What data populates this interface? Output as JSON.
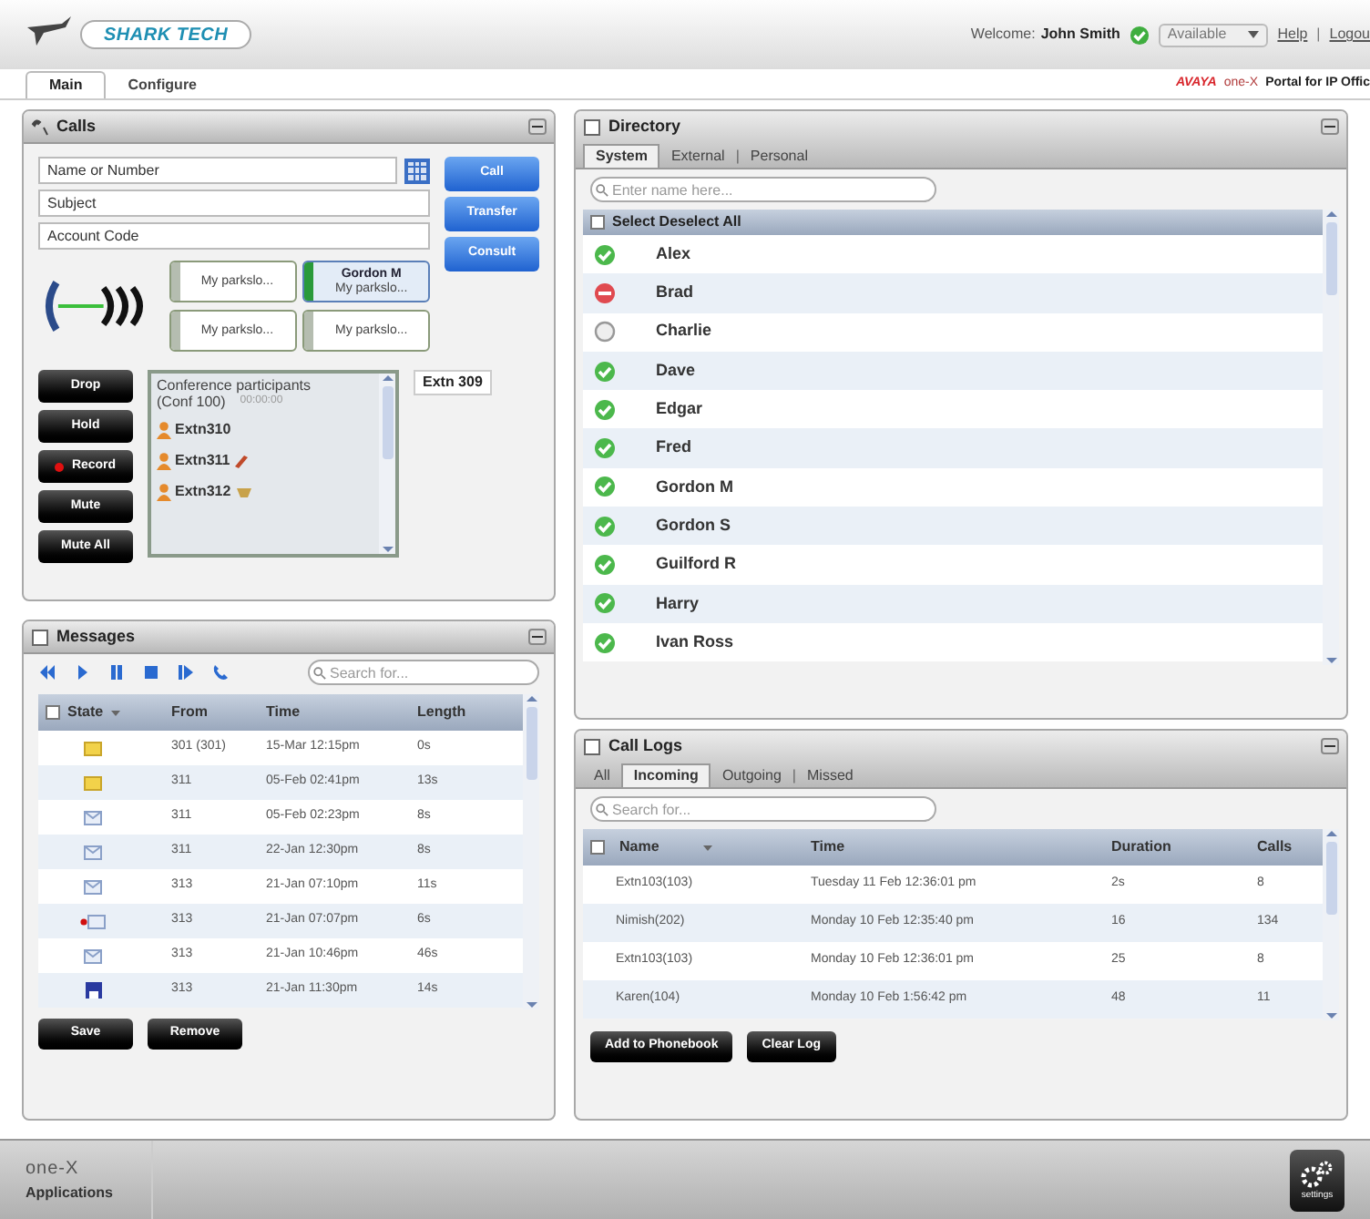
{
  "header": {
    "logo": "SHARK TECH",
    "welcome_label": "Welcome:",
    "user_name": "John Smith",
    "status": "Available",
    "links": [
      {
        "label": "Help",
        "separator_after": "|"
      },
      {
        "label": "Logou"
      }
    ]
  },
  "tabs": [
    {
      "label": "Main",
      "selected": true
    },
    {
      "label": "Configure",
      "selected": false
    }
  ],
  "branding": {
    "vendor": "AVAYA",
    "product": "one-X",
    "portal": "Portal for IP Offic"
  },
  "calls": {
    "title": "Calls",
    "fields": [
      {
        "placeholder": "Name or Number"
      },
      {
        "placeholder": "Subject"
      },
      {
        "placeholder": "Account Code"
      }
    ],
    "action_buttons": [
      "Call",
      "Transfer",
      "Consult"
    ],
    "park_slots": [
      {
        "label": "My parkslo...",
        "active": false
      },
      {
        "name": "Gordon M",
        "label": "My parkslo...",
        "active": true
      },
      {
        "label": "My parkslo...",
        "active": false
      },
      {
        "label": "My parkslo...",
        "active": false
      }
    ],
    "call_controls": [
      {
        "label": "Drop",
        "kind": "plain"
      },
      {
        "label": "Hold",
        "kind": "plain"
      },
      {
        "label": "Record",
        "kind": "record"
      },
      {
        "label": "Mute",
        "kind": "plain"
      },
      {
        "label": "Mute All",
        "kind": "plain"
      }
    ],
    "conference": {
      "title": "Conference participants",
      "conf": "(Conf 100)",
      "timer": "00:00:00",
      "participants": [
        {
          "name": "Extn310"
        },
        {
          "name": "Extn311",
          "kind": "pencil"
        },
        {
          "name": "Extn312",
          "kind": "cup"
        }
      ]
    },
    "extension": "Extn 309"
  },
  "directory": {
    "title": "Directory",
    "tabs": [
      {
        "label": "System",
        "selected": true
      },
      {
        "label": "External",
        "selected": false,
        "separator_after": "|"
      },
      {
        "label": "Personal",
        "selected": false
      }
    ],
    "search_placeholder": "Enter name here...",
    "select_all": {
      "label": "Select Deselect All",
      "checked": false
    },
    "entries": [
      {
        "name": "Alex",
        "kind": "available"
      },
      {
        "name": "Brad",
        "kind": "busy"
      },
      {
        "name": "Charlie",
        "kind": "offline"
      },
      {
        "name": "Dave",
        "kind": "available"
      },
      {
        "name": "Edgar",
        "kind": "available"
      },
      {
        "name": "Fred",
        "kind": "available"
      },
      {
        "name": "Gordon M",
        "kind": "available"
      },
      {
        "name": "Gordon S",
        "kind": "available"
      },
      {
        "name": "Guilford R",
        "kind": "available"
      },
      {
        "name": "Harry",
        "kind": "available"
      },
      {
        "name": "Ivan Ross",
        "kind": "available"
      }
    ]
  },
  "messages": {
    "title": "Messages",
    "search_placeholder": "Search for...",
    "header_checkbox": {
      "checked": false
    },
    "columns": [
      "State",
      "From",
      "Time",
      "Length"
    ],
    "rows": [
      {
        "kind": "unread",
        "from": "301 (301)",
        "time": "15-Mar 12:15pm",
        "length": "0s"
      },
      {
        "kind": "unread",
        "from": "311",
        "time": "05-Feb 02:41pm",
        "length": "13s"
      },
      {
        "kind": "read",
        "from": "311",
        "time": "05-Feb 02:23pm",
        "length": "8s"
      },
      {
        "kind": "read",
        "from": "311",
        "time": "22-Jan 12:30pm",
        "length": "8s"
      },
      {
        "kind": "read",
        "from": "313",
        "time": "21-Jan 07:10pm",
        "length": "11s"
      },
      {
        "kind": "urgent",
        "from": "313",
        "time": "21-Jan 07:07pm",
        "length": "6s"
      },
      {
        "kind": "read",
        "from": "313",
        "time": "21-Jan 10:46pm",
        "length": "46s"
      },
      {
        "kind": "saved",
        "from": "313",
        "time": "21-Jan 11:30pm",
        "length": "14s"
      }
    ],
    "buttons": [
      "Save",
      "Remove"
    ]
  },
  "call_logs": {
    "title": "Call Logs",
    "tabs": [
      {
        "label": "All",
        "selected": false
      },
      {
        "label": "Incoming",
        "selected": true
      },
      {
        "label": "Outgoing",
        "selected": false,
        "separator_after": "|"
      },
      {
        "label": "Missed",
        "selected": false
      }
    ],
    "search_placeholder": "Search for...",
    "header_checkbox": {
      "checked": false
    },
    "columns": [
      "Name",
      "Time",
      "Duration",
      "Calls"
    ],
    "rows": [
      {
        "name": "Extn103(103)",
        "time": "Tuesday 11 Feb 12:36:01 pm",
        "duration": "2s",
        "calls": "8"
      },
      {
        "name": "Nimish(202)",
        "time": "Monday 10 Feb 12:35:40 pm",
        "duration": "16",
        "calls": "134"
      },
      {
        "name": "Extn103(103)",
        "time": "Monday 10 Feb 12:36:01 pm",
        "duration": "25",
        "calls": "8"
      },
      {
        "name": "Karen(104)",
        "time": "Monday 10 Feb 1:56:42 pm",
        "duration": "48",
        "calls": "11"
      }
    ],
    "buttons": [
      "Add to Phonebook",
      "Clear Log"
    ]
  },
  "footer": {
    "logo": "one-X",
    "label": "Applications",
    "settings": "settings"
  }
}
